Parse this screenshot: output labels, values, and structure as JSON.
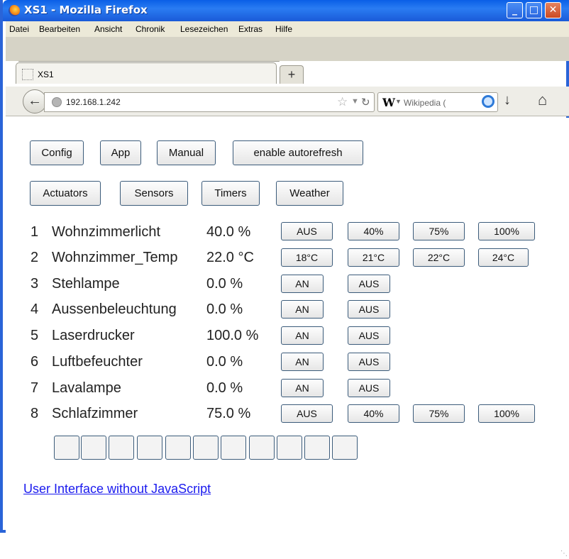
{
  "window": {
    "title": "XS1 - Mozilla Firefox",
    "minimize": "_",
    "maximize": "□",
    "close": "✕"
  },
  "menu": [
    "Datei",
    "Bearbeiten",
    "Ansicht",
    "Chronik",
    "Lesezeichen",
    "Extras",
    "Hilfe"
  ],
  "tab": {
    "label": "XS1",
    "new_tab": "+"
  },
  "nav": {
    "url": "192.168.1.242",
    "search_engine_placeholder": "Wikipedia (",
    "search_icon": "W"
  },
  "top_buttons": [
    "Config",
    "App",
    "Manual",
    "enable autorefresh"
  ],
  "section_buttons": [
    "Actuators",
    "Sensors",
    "Timers",
    "Weather"
  ],
  "actuators": [
    {
      "index": "1",
      "name": "Wohnzimmerlicht",
      "value": "40.0 %",
      "buttons": [
        "AUS",
        "40%",
        "75%",
        "100%"
      ]
    },
    {
      "index": "2",
      "name": "Wohnzimmer_Temp",
      "value": "22.0 °C",
      "buttons": [
        "18°C",
        "21°C",
        "22°C",
        "24°C"
      ]
    },
    {
      "index": "3",
      "name": "Stehlampe",
      "value": "0.0 %",
      "buttons": [
        "AN",
        "AUS"
      ]
    },
    {
      "index": "4",
      "name": "Aussenbeleuchtung",
      "value": "0.0 %",
      "buttons": [
        "AN",
        "AUS"
      ]
    },
    {
      "index": "5",
      "name": "Laserdrucker",
      "value": "100.0 %",
      "buttons": [
        "AN",
        "AUS"
      ]
    },
    {
      "index": "6",
      "name": "Luftbefeuchter",
      "value": "0.0 %",
      "buttons": [
        "AN",
        "AUS"
      ]
    },
    {
      "index": "7",
      "name": "Lavalampe",
      "value": "0.0 %",
      "buttons": [
        "AN",
        "AUS"
      ]
    },
    {
      "index": "8",
      "name": "Schlafzimmer",
      "value": "75.0 %",
      "buttons": [
        "AUS",
        "40%",
        "75%",
        "100%"
      ]
    }
  ],
  "link": "User Interface without JavaScript"
}
